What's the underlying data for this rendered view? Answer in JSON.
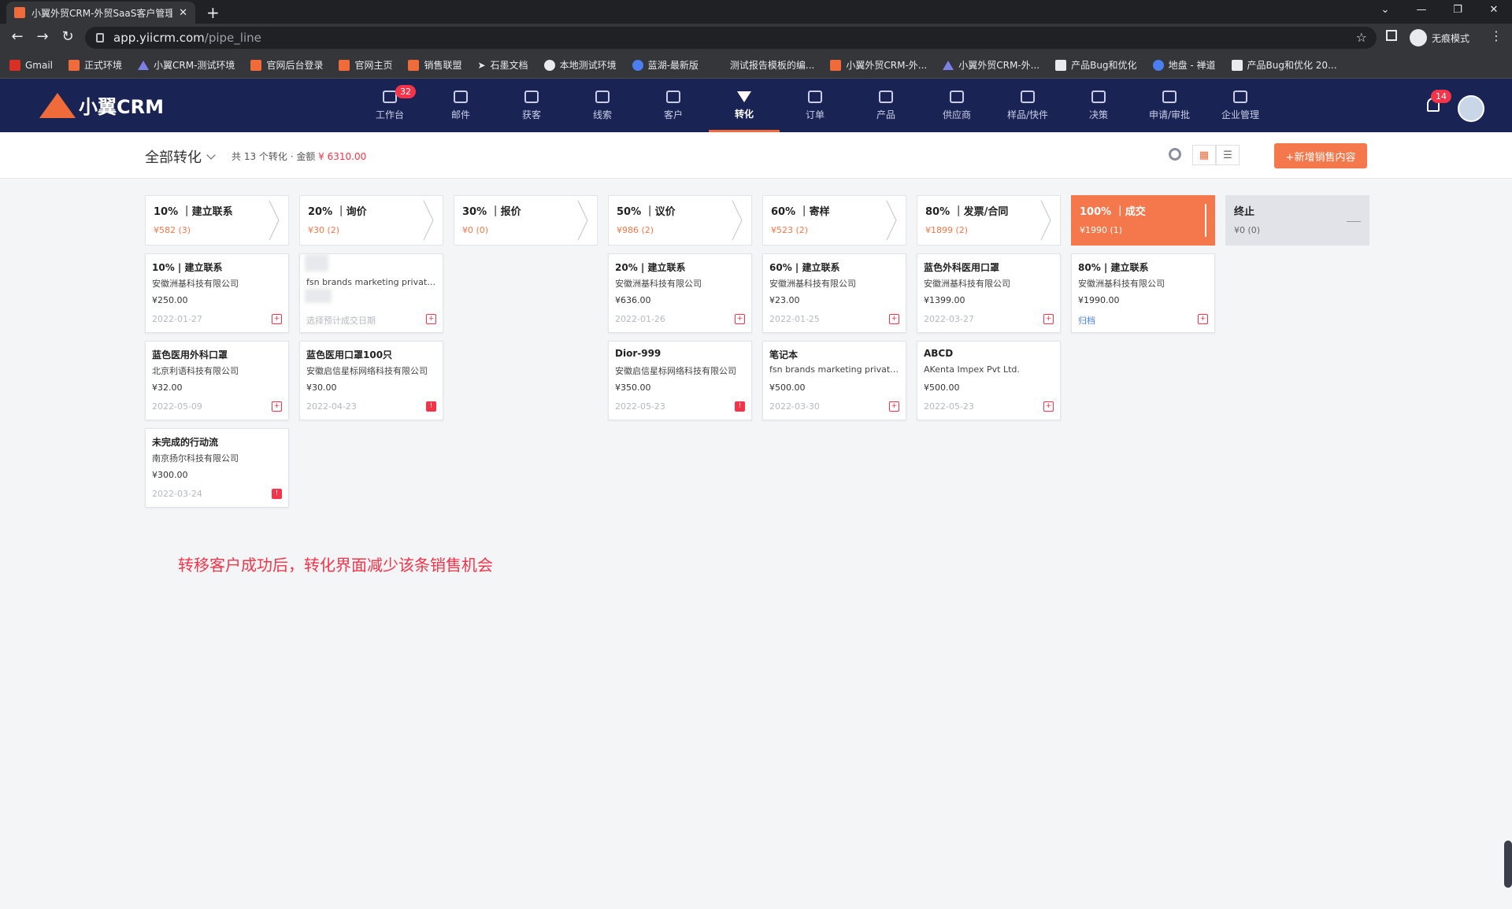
{
  "browser": {
    "tab_title": "小翼外贸CRM-外贸SaaS客户管理",
    "url_host": "app.yiicrm.com",
    "url_path": "/pipe_line",
    "incognito_label": "无痕模式",
    "bookmarks": [
      {
        "label": "Gmail",
        "icon": "gmail-icon"
      },
      {
        "label": "正式环境",
        "icon": "yiicrm-icon"
      },
      {
        "label": "小翼CRM-测试环境",
        "icon": "triangle-icon"
      },
      {
        "label": "官网后台登录",
        "icon": "yiicrm-icon"
      },
      {
        "label": "官网主页",
        "icon": "yiicrm-icon"
      },
      {
        "label": "销售联盟",
        "icon": "yiicrm-icon"
      },
      {
        "label": "石墨文档",
        "icon": "arrow-icon"
      },
      {
        "label": "本地测试环境",
        "icon": "github-icon"
      },
      {
        "label": "蓝湖-最新版",
        "icon": "lanhu-icon"
      },
      {
        "label": "测试报告模板的编...",
        "icon": "none"
      },
      {
        "label": "小翼外贸CRM-外...",
        "icon": "yiicrm-icon"
      },
      {
        "label": "小翼外贸CRM-外...",
        "icon": "triangle-icon"
      },
      {
        "label": "产品Bug和优化",
        "icon": "doc-icon"
      },
      {
        "label": "地盘 - 禅道",
        "icon": "zentao-icon"
      },
      {
        "label": "产品Bug和优化 20...",
        "icon": "doc-icon"
      }
    ]
  },
  "app": {
    "logo_text": "小翼CRM",
    "nav": [
      {
        "label": "工作台",
        "badge": "32"
      },
      {
        "label": "邮件"
      },
      {
        "label": "获客"
      },
      {
        "label": "线索"
      },
      {
        "label": "客户"
      },
      {
        "label": "转化",
        "active": true
      },
      {
        "label": "订单"
      },
      {
        "label": "产品"
      },
      {
        "label": "供应商"
      },
      {
        "label": "样品/快件"
      },
      {
        "label": "决策"
      },
      {
        "label": "申请/审批"
      },
      {
        "label": "企业管理"
      }
    ],
    "notification_badge": "14"
  },
  "toolbar": {
    "view_title": "全部转化",
    "summary_prefix": "共 13 个转化 · 金额 ",
    "summary_amount": "¥ 6310.00",
    "add_button": "+新增销售内容"
  },
  "stages": [
    {
      "name": "10% ｜建立联系",
      "summary": "¥582 (3)",
      "style": "normal"
    },
    {
      "name": "20% ｜询价",
      "summary": "¥30 (2)",
      "style": "normal"
    },
    {
      "name": "30% ｜报价",
      "summary": "¥0 (0)",
      "style": "normal"
    },
    {
      "name": "50% ｜议价",
      "summary": "¥986 (2)",
      "style": "normal"
    },
    {
      "name": "60% ｜寄样",
      "summary": "¥523 (2)",
      "style": "normal"
    },
    {
      "name": "80% ｜发票/合同",
      "summary": "¥1899 (2)",
      "style": "normal"
    },
    {
      "name": "100% ｜成交",
      "summary": "¥1990 (1)",
      "style": "done"
    },
    {
      "name": "终止",
      "summary": "¥0 (0)",
      "style": "stop"
    }
  ],
  "cards": [
    [
      {
        "title": "10% | 建立联系",
        "company": "安徽洲基科技有限公司",
        "value": "¥250.00",
        "date": "2022-01-27",
        "icon": "add"
      },
      {
        "title": "蓝色医用外科口罩",
        "company": "北京利语科技有限公司",
        "value": "¥32.00",
        "date": "2022-05-09",
        "icon": "add"
      },
      {
        "title": "未完成的行动流",
        "company": "南京扬尔科技有限公司",
        "value": "¥300.00",
        "date": "2022-03-24",
        "icon": "overdue"
      }
    ],
    [
      {
        "title": "",
        "company": "fsn brands marketing private limited",
        "value": "",
        "date": "选择预计成交日期",
        "icon": "add",
        "blurred": true
      },
      {
        "title": "蓝色医用口罩100只",
        "company": "安徽启信星标网络科技有限公司",
        "value": "¥30.00",
        "date": "2022-04-23",
        "icon": "overdue"
      }
    ],
    [],
    [
      {
        "title": "20% | 建立联系",
        "company": "安徽洲基科技有限公司",
        "value": "¥636.00",
        "date": "2022-01-26",
        "icon": "add"
      },
      {
        "title": "Dior-999",
        "company": "安徽启信星标网络科技有限公司",
        "value": "¥350.00",
        "date": "2022-05-23",
        "icon": "overdue"
      }
    ],
    [
      {
        "title": "60% | 建立联系",
        "company": "安徽洲基科技有限公司",
        "value": "¥23.00",
        "date": "2022-01-25",
        "icon": "add"
      },
      {
        "title": "笔记本",
        "company": "fsn brands marketing private limited",
        "value": "¥500.00",
        "date": "2022-03-30",
        "icon": "add"
      }
    ],
    [
      {
        "title": "蓝色外科医用口罩",
        "company": "安徽洲基科技有限公司",
        "value": "¥1399.00",
        "date": "2022-03-27",
        "icon": "add"
      },
      {
        "title": "ABCD",
        "company": "AKenta Impex Pvt Ltd.",
        "value": "¥500.00",
        "date": "2022-05-23",
        "icon": "add"
      }
    ],
    [
      {
        "title": "80% | 建立联系",
        "company": "安徽洲基科技有限公司",
        "value": "¥1990.00",
        "date": "归档",
        "icon": "add",
        "link": true
      }
    ],
    []
  ],
  "annotation": "转移客户成功后，转化界面减少该条销售机会",
  "colors": {
    "accent": "#f5784c",
    "header_bg": "#192455",
    "danger": "#f5344a"
  }
}
